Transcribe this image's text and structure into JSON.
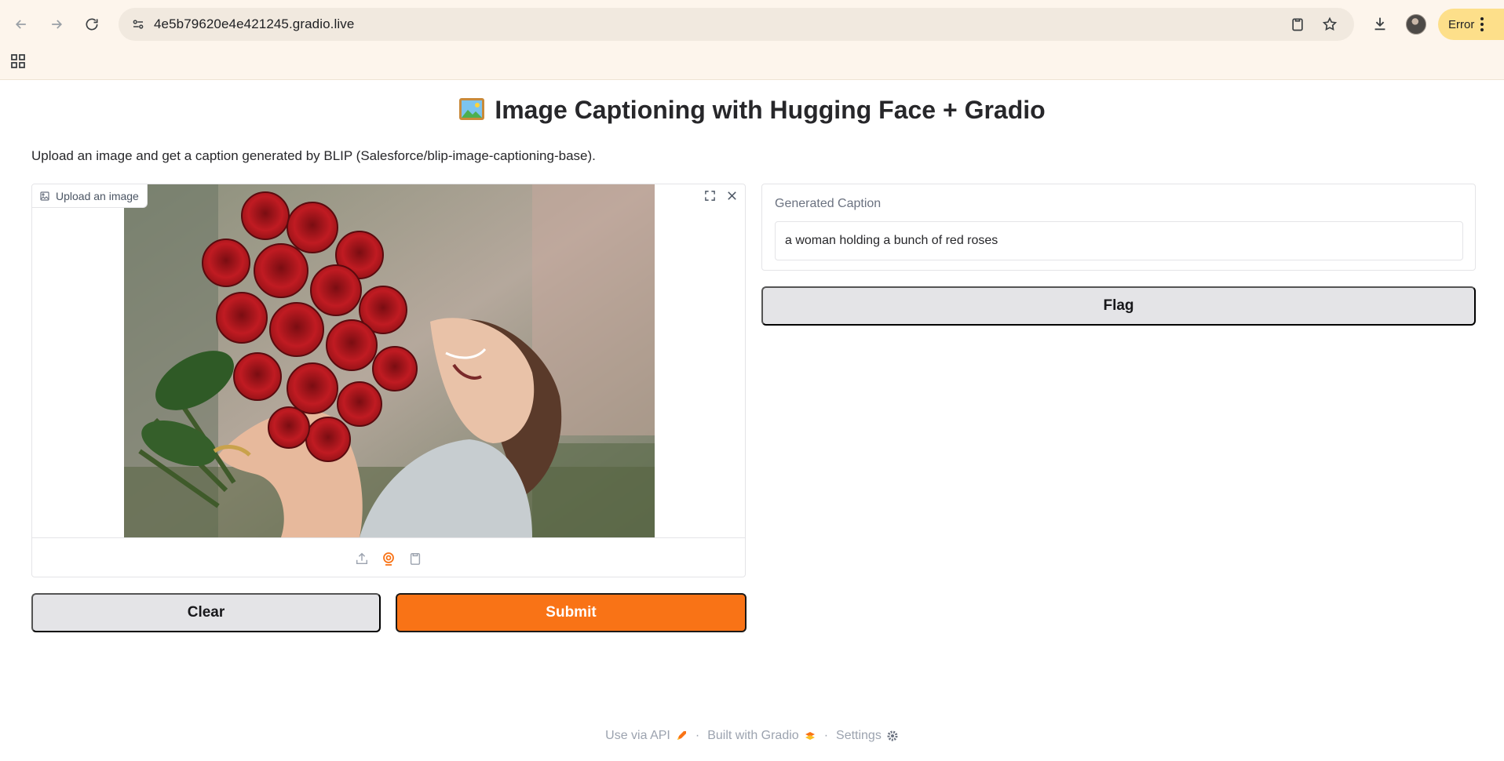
{
  "browser": {
    "url": "4e5b79620e4e421245.gradio.live",
    "error_label": "Error",
    "icons": [
      "back-icon",
      "forward-icon",
      "reload-icon",
      "site-settings-icon",
      "clipboard-icon",
      "star-icon",
      "download-icon",
      "profile-avatar",
      "apps-icon"
    ]
  },
  "page": {
    "title": "Image Captioning with Hugging Face + Gradio",
    "description": "Upload an image and get a caption generated by BLIP (Salesforce/blip-image-captioning-base)."
  },
  "image_input": {
    "label": "Upload an image",
    "sources": [
      "upload-icon",
      "webcam-icon",
      "clipboard-icon"
    ],
    "active_source": "webcam-icon"
  },
  "buttons": {
    "clear": "Clear",
    "submit": "Submit",
    "flag": "Flag"
  },
  "output": {
    "label": "Generated Caption",
    "value": "a woman holding a bunch of red roses"
  },
  "footer": {
    "api": "Use via API",
    "built": "Built with Gradio",
    "settings": "Settings",
    "separator": "·"
  },
  "colors": {
    "accent": "#f97316",
    "secondary_button": "#e4e4e7",
    "chrome_bg": "#fdf5ec"
  }
}
